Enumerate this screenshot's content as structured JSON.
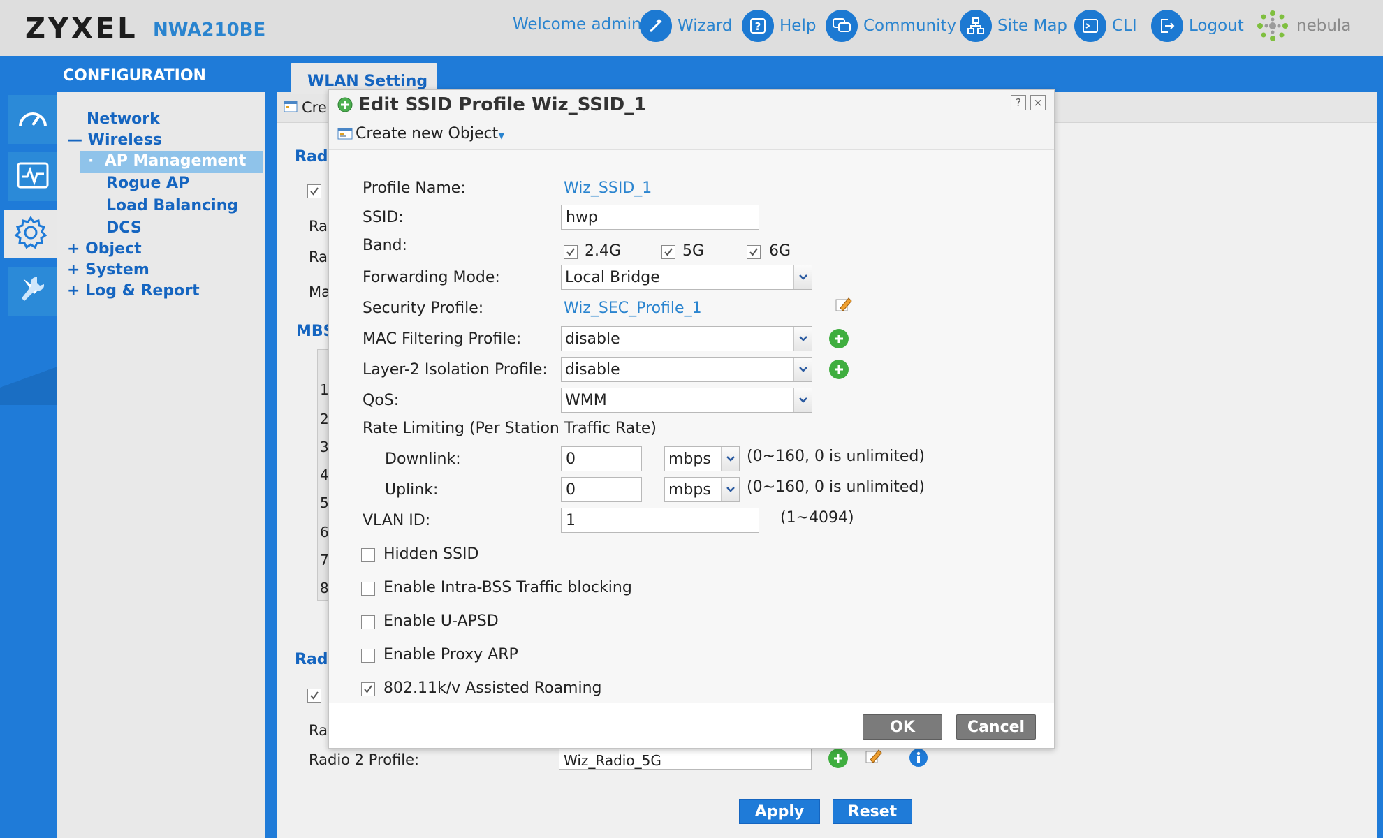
{
  "header": {
    "logo": "ZYXEL",
    "model": "NWA210BE",
    "welcome": "Welcome admin",
    "nav": [
      {
        "label": "Wizard",
        "icon": "wand-icon"
      },
      {
        "label": "Help",
        "icon": "help-icon"
      },
      {
        "label": "Community",
        "icon": "chat-icon"
      },
      {
        "label": "Site Map",
        "icon": "sitemap-icon"
      },
      {
        "label": "CLI",
        "icon": "terminal-icon"
      },
      {
        "label": "Logout",
        "icon": "logout-icon"
      }
    ],
    "nebula": "nebula",
    "accent": "#1f7bd8"
  },
  "sidebar": {
    "section_title": "CONFIGURATION",
    "items": [
      {
        "label": "Network",
        "prefix": ""
      },
      {
        "label": "Wireless",
        "prefix": "—"
      },
      {
        "label": "AP Management",
        "prefix": "·",
        "selected": true
      },
      {
        "label": "Rogue AP",
        "prefix": ""
      },
      {
        "label": "Load Balancing",
        "prefix": ""
      },
      {
        "label": "DCS",
        "prefix": ""
      },
      {
        "label": "Object",
        "prefix": "+"
      },
      {
        "label": "System",
        "prefix": "+"
      },
      {
        "label": "Log & Report",
        "prefix": "+"
      }
    ]
  },
  "main": {
    "tab": "WLAN Setting",
    "toolbar_partial": "Cre",
    "bg_labels": {
      "radio_section_1": "Radi",
      "ra_1": "Ra",
      "ra_2": "Ra",
      "ma": "Ma",
      "mbs": "MBS",
      "radio_section_2": "Radi",
      "ra_3": "Ra",
      "radio2_profile": "Radio 2 Profile:",
      "radio2_value": "Wiz_Radio_5G"
    },
    "row_numbers": [
      "1",
      "2",
      "3",
      "4",
      "5",
      "6",
      "7",
      "8"
    ],
    "apply": "Apply",
    "reset": "Reset"
  },
  "dialog": {
    "title": "Edit SSID Profile Wiz_SSID_1",
    "help_ctl": "?",
    "close_ctl": "×",
    "toolbar": "Create new Object",
    "profile_name_label": "Profile Name:",
    "profile_name_value": "Wiz_SSID_1",
    "ssid_label": "SSID:",
    "ssid_value": "hwp",
    "band_label": "Band:",
    "bands": [
      {
        "label": "2.4G",
        "checked": true
      },
      {
        "label": "5G",
        "checked": true
      },
      {
        "label": "6G",
        "checked": true
      }
    ],
    "forwarding_label": "Forwarding Mode:",
    "forwarding_value": "Local Bridge",
    "security_label": "Security Profile:",
    "security_value": "Wiz_SEC_Profile_1",
    "mac_label": "MAC Filtering Profile:",
    "mac_value": "disable",
    "l2_label": "Layer-2 Isolation Profile:",
    "l2_value": "disable",
    "qos_label": "QoS:",
    "qos_value": "WMM",
    "rate_label": "Rate Limiting (Per Station Traffic Rate)",
    "downlink_label": "Downlink:",
    "downlink_value": "0",
    "downlink_unit": "mbps",
    "downlink_hint": "(0~160, 0 is unlimited)",
    "uplink_label": "Uplink:",
    "uplink_value": "0",
    "uplink_unit": "mbps",
    "uplink_hint": "(0~160, 0 is unlimited)",
    "vlan_label": "VLAN ID:",
    "vlan_value": "1",
    "vlan_hint": "(1~4094)",
    "options": [
      {
        "label": "Hidden SSID",
        "checked": false
      },
      {
        "label": "Enable Intra-BSS Traffic blocking",
        "checked": false
      },
      {
        "label": "Enable U-APSD",
        "checked": false
      },
      {
        "label": "Enable Proxy ARP",
        "checked": false
      },
      {
        "label": "802.11k/v Assisted Roaming",
        "checked": true
      }
    ],
    "ok": "OK",
    "cancel": "Cancel"
  }
}
